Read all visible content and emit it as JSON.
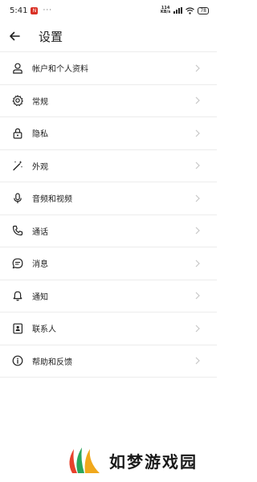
{
  "status_bar": {
    "time": "5:41",
    "notif_badge": "N",
    "dots": "···",
    "net_speed_value": "114",
    "net_speed_unit": "KB/s",
    "battery": "78"
  },
  "header": {
    "title": "设置"
  },
  "settings": {
    "items": [
      {
        "label": "帐户和个人资料",
        "icon": "person-icon"
      },
      {
        "label": "常规",
        "icon": "gear-icon"
      },
      {
        "label": "隐私",
        "icon": "lock-icon"
      },
      {
        "label": "外观",
        "icon": "magic-wand-icon"
      },
      {
        "label": "音频和视频",
        "icon": "microphone-icon"
      },
      {
        "label": "通话",
        "icon": "phone-icon"
      },
      {
        "label": "消息",
        "icon": "chat-icon"
      },
      {
        "label": "通知",
        "icon": "bell-icon"
      },
      {
        "label": "联系人",
        "icon": "contacts-icon"
      },
      {
        "label": "帮助和反馈",
        "icon": "info-icon"
      }
    ]
  },
  "watermark": {
    "text": "如梦游戏园"
  },
  "colors": {
    "text": "#1f1f1f",
    "divider": "#ececec",
    "chevron": "#c7c7c7",
    "badge": "#d93025"
  }
}
